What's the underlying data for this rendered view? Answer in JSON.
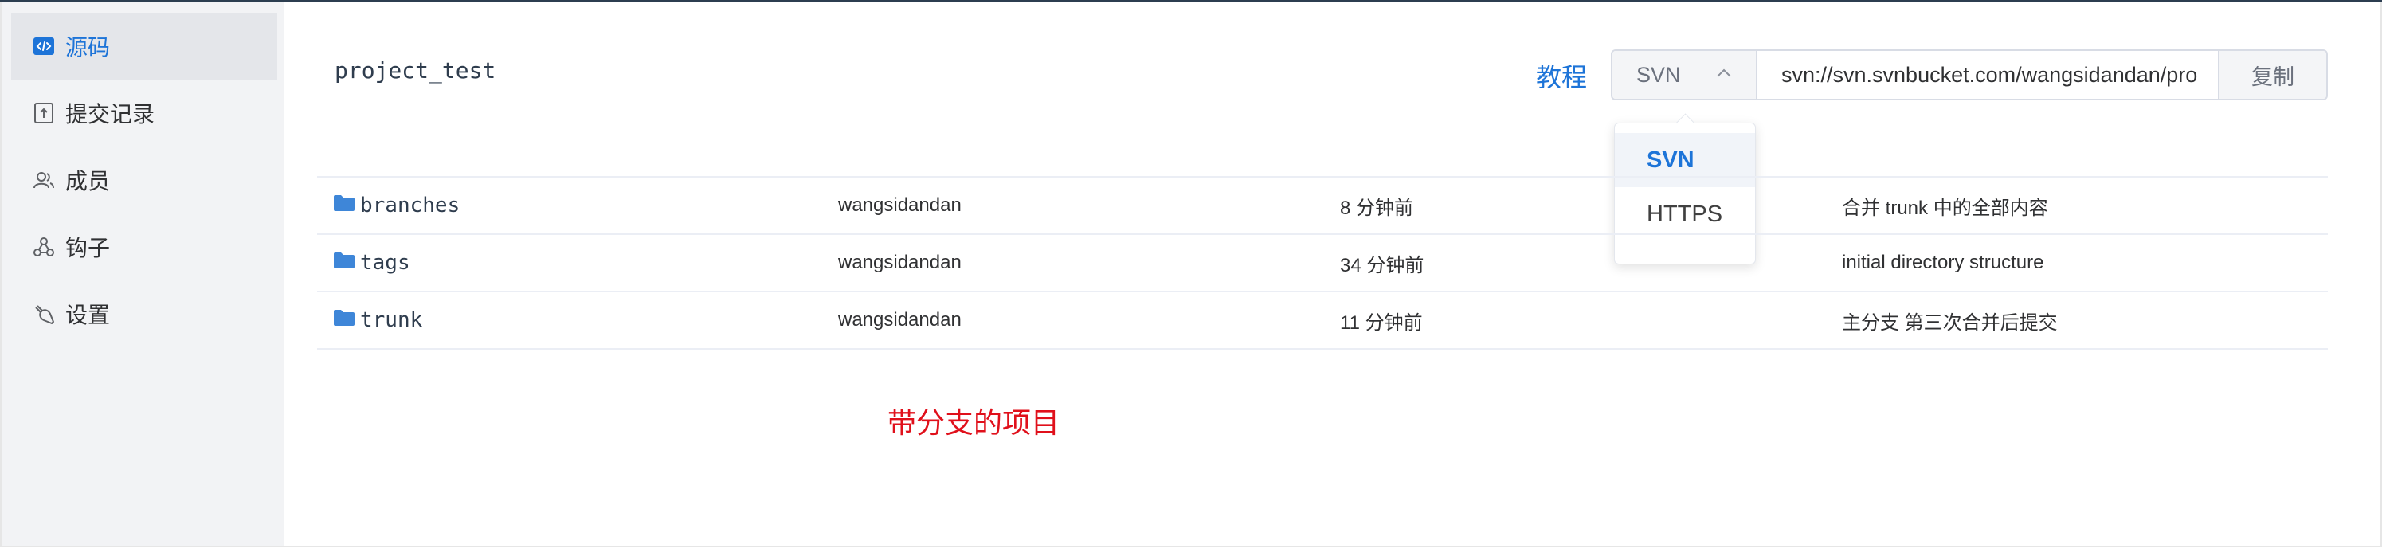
{
  "sidebar": {
    "items": [
      {
        "label": "源码",
        "icon": "code-icon",
        "active": true
      },
      {
        "label": "提交记录",
        "icon": "commit-history-icon",
        "active": false
      },
      {
        "label": "成员",
        "icon": "members-icon",
        "active": false
      },
      {
        "label": "钩子",
        "icon": "webhook-icon",
        "active": false
      },
      {
        "label": "设置",
        "icon": "settings-icon",
        "active": false
      }
    ]
  },
  "project": {
    "name": "project_test"
  },
  "clone": {
    "tutorial_label": "教程",
    "protocol": "SVN",
    "url": "svn://svn.svnbucket.com/wangsidandan/pro",
    "copy_label": "复制"
  },
  "protocol_dropdown": {
    "options": [
      "SVN",
      "HTTPS"
    ],
    "selected": "SVN"
  },
  "files": [
    {
      "name": "branches",
      "author": "wangsidandan",
      "time": "8 分钟前",
      "message": "合并 trunk 中的全部内容"
    },
    {
      "name": "tags",
      "author": "wangsidandan",
      "time": "34 分钟前",
      "message": "initial directory structure"
    },
    {
      "name": "trunk",
      "author": "wangsidandan",
      "time": "11 分钟前",
      "message": "主分支 第三次合并后提交"
    }
  ],
  "annotation": {
    "text": "带分支的项目"
  },
  "colors": {
    "accent": "#1d74d8",
    "folder": "#3e86d8",
    "annotation": "#e0101b",
    "sidebar_bg": "#f2f3f5"
  }
}
